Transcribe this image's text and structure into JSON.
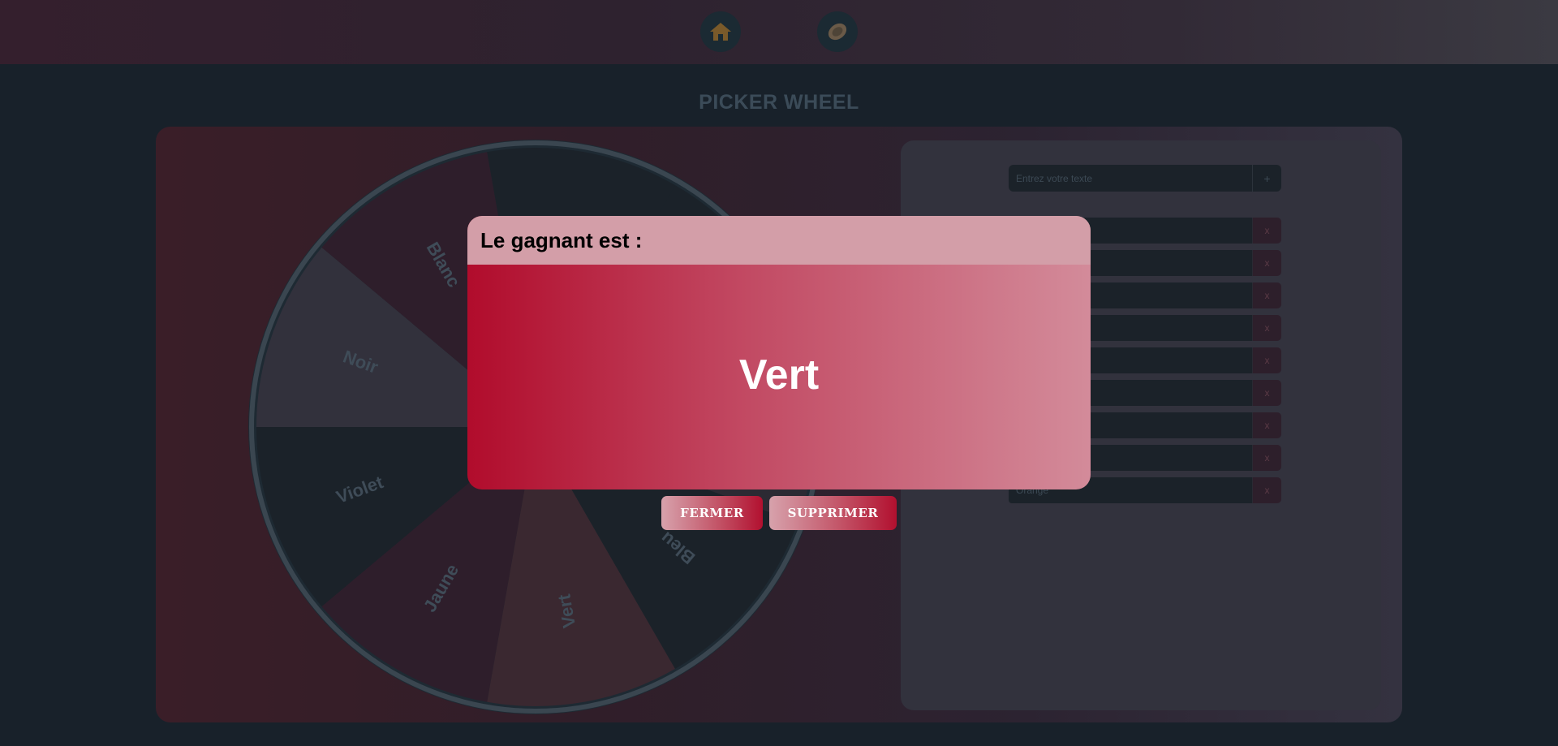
{
  "nav": {
    "items": [
      {
        "icon": "home-icon"
      },
      {
        "icon": "wheel-icon"
      }
    ]
  },
  "page": {
    "title": "PICKER WHEEL"
  },
  "wheel": {
    "slices": [
      {
        "label": "Blanc",
        "color": "#2e1e2b"
      },
      {
        "label": "Noir",
        "color": "#32313c"
      },
      {
        "label": "Violet",
        "color": "#1b2229"
      },
      {
        "label": "Jaune",
        "color": "#2e1e2b"
      },
      {
        "label": "Vert",
        "color": "#3a2830"
      },
      {
        "label": "Bleu",
        "color": "#1b2229"
      },
      {
        "label": "",
        "color": "#2c2a33"
      },
      {
        "label": "",
        "color": "#1b2229"
      },
      {
        "label": "",
        "color": "#1b2229"
      }
    ]
  },
  "panel": {
    "input_placeholder": "Entrez votre texte",
    "add_label": "+",
    "delete_label": "x",
    "entries": [
      "",
      "",
      "",
      "",
      "",
      "",
      "",
      "",
      "Orange"
    ]
  },
  "modal": {
    "title": "Le gagnant est :",
    "winner": "Vert",
    "close_label": "FERMER",
    "delete_label": "SUPPRIMER"
  },
  "colors": {
    "accent": "#b10c2c",
    "accent_light": "#d38b9a"
  }
}
